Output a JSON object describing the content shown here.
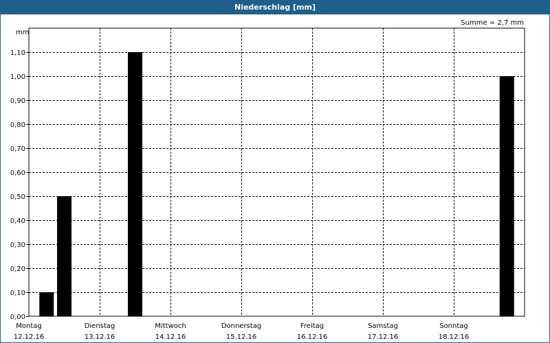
{
  "window": {
    "title": "Niederschlag [mm]"
  },
  "chart_data": {
    "type": "bar",
    "title": "Niederschlag [mm]",
    "ylabel": "mm",
    "ylim": [
      0,
      1.2
    ],
    "yticks": [
      "0,00",
      "0,10",
      "0,20",
      "0,30",
      "0,40",
      "0,50",
      "0,60",
      "0,70",
      "0,80",
      "0,90",
      "1,00",
      "1,10"
    ],
    "annotation": "Summe = 2,7 mm",
    "grid": true,
    "x_day_labels": [
      {
        "day": "Montag",
        "date": "12.12.16"
      },
      {
        "day": "Dienstag",
        "date": "13.12.16"
      },
      {
        "day": "Mittwoch",
        "date": "14.12.16"
      },
      {
        "day": "Donnerstag",
        "date": "15.12.16"
      },
      {
        "day": "Freitag",
        "date": "16.12.16"
      },
      {
        "day": "Samstag",
        "date": "17.12.16"
      },
      {
        "day": "Sonntag",
        "date": "18.12.16"
      }
    ],
    "bars": [
      {
        "x": "12.12.16 06:00",
        "value": 0.1
      },
      {
        "x": "12.12.16 12:00",
        "value": 0.5
      },
      {
        "x": "13.12.16 12:00",
        "value": 1.1
      },
      {
        "x": "18.12.16 18:00",
        "value": 1.0
      }
    ],
    "colors": {
      "bar": "#000000",
      "header": "#1f5f8b",
      "grid": "#000000"
    }
  }
}
